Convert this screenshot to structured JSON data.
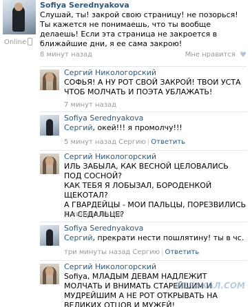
{
  "post": {
    "author": "Sofiya Serednyakova",
    "status": "Online",
    "text": "Слушай, ты! закрой свою страницу! не позорься! Ты кажется не понимаешь, что ты вообще делаешь! Если эта страница не закроется в ближайшие дни, я ее сама закрою!",
    "time": "8 минут назад",
    "like_label": "Мне нравится",
    "like_icon": "♥"
  },
  "comments": [
    {
      "author": "Сергий Никологорский",
      "text": "СОФЬЯ! А НУ РОТ СВОЙ ЗАКРОЙ! ТВОИ УСТА ЧТОБ МОЛЧАТЬ И ПОЭТА УБЛАЖАТЬ!",
      "time": "7 минут назад"
    },
    {
      "author": "Sofiya Serednyakova",
      "addressee": "Сергий",
      "text": ", окей!!! я промолчу!!!",
      "time": "5 минут назад Сергию",
      "reply": "Ответить"
    },
    {
      "author": "Сергий Никологорский",
      "text": "ИЛЬ ЗАБЫЛА, КАК ВЕСНОЙ ЦЕЛОВАЛИСЬ ПОД СОСНОЙ?\nКАК ТЕБЯ Я ЛОБЫЗАЛ, БОРОДЕНКОЙ ЩЕКОТАЛ?\nА ГВАРДЕЙЦЫ - МОИ ПАЛЬЦЫ, ПОРЕЗВИЛИСЬ НА СЕДАЛЬЦЕ?",
      "time": "4 минуты назад"
    },
    {
      "author": "Sofiya Serednyakova",
      "addressee": "Сергий",
      "text": ", прекрати нести пошлятину! ты в чс.",
      "time": "три минуты назад Сергию",
      "reply": "Ответить"
    },
    {
      "author": "Сергий Никологорский",
      "text": "Sofiya, МЛАДЫМ ДЕВАМ НАДЛЕЖИТ МОЛЧАТЬ И ВНИМАТЬ СТАРЕЙШИМ И МУДРЕЙШИМ А НЕ РОТ ОТКРЫВАТЬ НА ВЕЛИКИХ ОТЦОВ И МУЖЕЙ!"
    }
  ],
  "watermark": "ЯПЛАКАЛ.COM",
  "colors": {
    "link": "#2b587a",
    "muted": "#999999",
    "separator": "#e2e8ee"
  }
}
